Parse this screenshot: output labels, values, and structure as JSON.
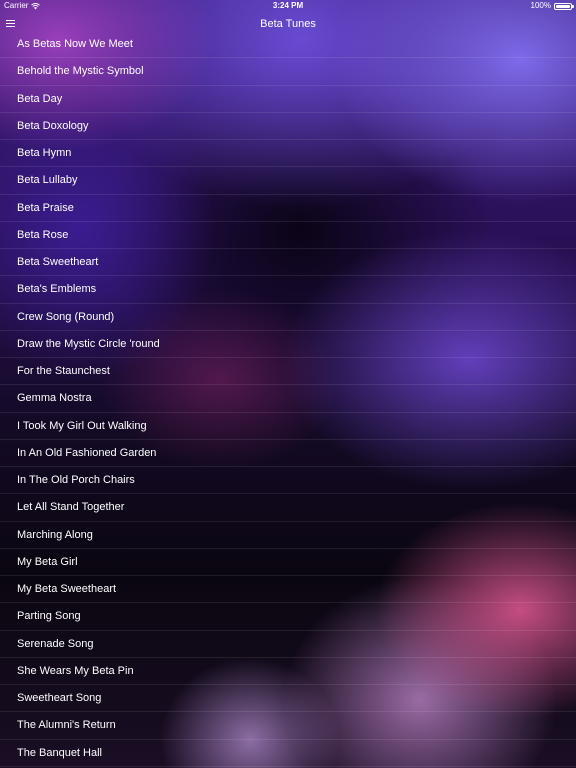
{
  "status_bar": {
    "carrier": "Carrier",
    "time": "3:24 PM",
    "battery": "100%",
    "battery_level": 1.0,
    "wifi_icon": "wifi-icon",
    "battery_icon": "battery-icon"
  },
  "nav": {
    "title": "Beta Tunes",
    "menu_icon": "hamburger-menu-icon"
  },
  "songs": [
    "As Betas Now We Meet",
    "Behold the Mystic Symbol",
    "Beta Day",
    "Beta Doxology",
    "Beta Hymn",
    "Beta Lullaby",
    "Beta Praise",
    "Beta Rose",
    "Beta Sweetheart",
    "Beta's Emblems",
    "Crew Song (Round)",
    "Draw the Mystic Circle 'round",
    "For the Staunchest",
    "Gemma Nostra",
    "I Took My Girl Out Walking",
    "In An Old Fashioned Garden",
    "In The Old Porch Chairs",
    "Let All Stand Together",
    "Marching Along",
    "My Beta Girl",
    "My Beta Sweetheart",
    "Parting Song",
    "Serenade Song",
    "She Wears My Beta Pin",
    "Sweetheart Song",
    "The Alumni's Return",
    "The Banquet Hall"
  ],
  "colors": {
    "text": "#ffffff",
    "separator": "#ffffff17"
  }
}
